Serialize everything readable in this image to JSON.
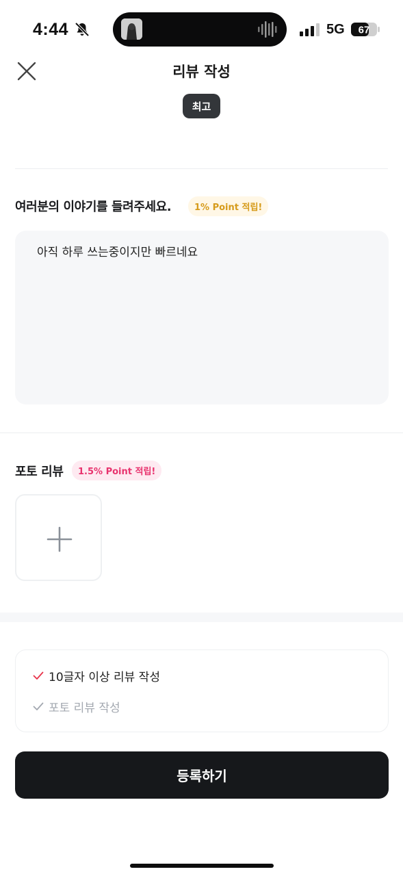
{
  "status_bar": {
    "time": "4:44",
    "network": "5G",
    "battery": "67",
    "icons": [
      "bell-slash-icon",
      "signal-icon",
      "battery-icon",
      "waveform-icon"
    ]
  },
  "header": {
    "title": "리뷰 작성",
    "rating_label": "최고",
    "close_icon": "close-icon"
  },
  "story": {
    "heading": "여러분의 이야기를 들려주세요.",
    "point_chip": "1% Point 적립!",
    "review_text": "아직 하루 쓰는중이지만 빠르네요"
  },
  "photo": {
    "heading": "포토 리뷰",
    "point_chip": "1.5% Point 적립!",
    "add_icon": "plus-icon"
  },
  "checklist": {
    "items": [
      {
        "label": "10글자 이상 리뷰 작성",
        "checked": true
      },
      {
        "label": "포토 리뷰 작성",
        "checked": false
      }
    ]
  },
  "submit": {
    "label": "등록하기"
  },
  "colors": {
    "accent_yellow": "#d69b1b",
    "accent_pink": "#e8336e",
    "check_red": "#e8334a",
    "button_dark": "#16181b"
  }
}
